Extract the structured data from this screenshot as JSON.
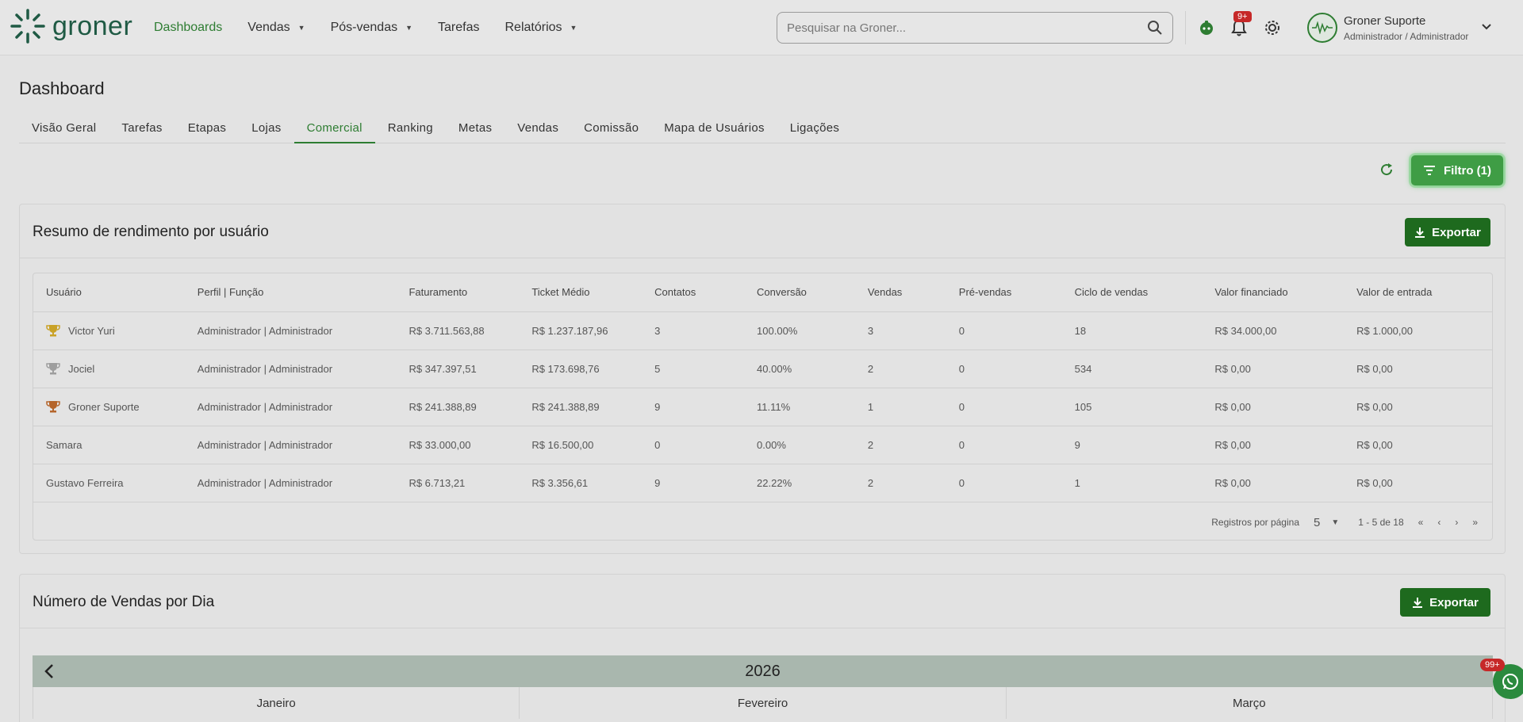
{
  "brand": {
    "name": "groner",
    "color": "#1f5a44",
    "accent": "#2e7d32"
  },
  "nav": [
    {
      "label": "Dashboards",
      "active": true,
      "dropdown": false
    },
    {
      "label": "Vendas",
      "active": false,
      "dropdown": true
    },
    {
      "label": "Pós-vendas",
      "active": false,
      "dropdown": true
    },
    {
      "label": "Tarefas",
      "active": false,
      "dropdown": false
    },
    {
      "label": "Relatórios",
      "active": false,
      "dropdown": true
    }
  ],
  "search": {
    "placeholder": "Pesquisar na Groner..."
  },
  "notifications": {
    "badge": "9+"
  },
  "user": {
    "name": "Groner Suporte",
    "role": "Administrador / Administrador"
  },
  "page": {
    "title": "Dashboard"
  },
  "tabs": [
    {
      "label": "Visão Geral",
      "active": false
    },
    {
      "label": "Tarefas",
      "active": false
    },
    {
      "label": "Etapas",
      "active": false
    },
    {
      "label": "Lojas",
      "active": false
    },
    {
      "label": "Comercial",
      "active": true
    },
    {
      "label": "Ranking",
      "active": false
    },
    {
      "label": "Metas",
      "active": false
    },
    {
      "label": "Vendas",
      "active": false
    },
    {
      "label": "Comissão",
      "active": false
    },
    {
      "label": "Mapa de Usuários",
      "active": false
    },
    {
      "label": "Ligações",
      "active": false
    }
  ],
  "toolbar": {
    "filter_label": "Filtro (1)"
  },
  "summary": {
    "title": "Resumo de rendimento por usuário",
    "export_label": "Exportar",
    "columns": [
      "Usuário",
      "Perfil | Função",
      "Faturamento",
      "Ticket Médio",
      "Contatos",
      "Conversão",
      "Vendas",
      "Pré-vendas",
      "Ciclo de vendas",
      "Valor financiado",
      "Valor de entrada"
    ],
    "rows": [
      {
        "trophy": "gold",
        "cells": [
          "Victor Yuri",
          "Administrador | Administrador",
          "R$ 3.711.563,88",
          "R$ 1.237.187,96",
          "3",
          "100.00%",
          "3",
          "0",
          "18",
          "R$ 34.000,00",
          "R$ 1.000,00"
        ]
      },
      {
        "trophy": "silver",
        "cells": [
          "Jociel",
          "Administrador | Administrador",
          "R$ 347.397,51",
          "R$ 173.698,76",
          "5",
          "40.00%",
          "2",
          "0",
          "534",
          "R$ 0,00",
          "R$ 0,00"
        ]
      },
      {
        "trophy": "bronze",
        "cells": [
          "Groner Suporte",
          "Administrador | Administrador",
          "R$ 241.388,89",
          "R$ 241.388,89",
          "9",
          "11.11%",
          "1",
          "0",
          "105",
          "R$ 0,00",
          "R$ 0,00"
        ]
      },
      {
        "trophy": "",
        "cells": [
          "Samara",
          "Administrador | Administrador",
          "R$ 33.000,00",
          "R$ 16.500,00",
          "0",
          "0.00%",
          "2",
          "0",
          "9",
          "R$ 0,00",
          "R$ 0,00"
        ]
      },
      {
        "trophy": "",
        "cells": [
          "Gustavo Ferreira",
          "Administrador | Administrador",
          "R$ 6.713,21",
          "R$ 3.356,61",
          "9",
          "22.22%",
          "2",
          "0",
          "1",
          "R$ 0,00",
          "R$ 0,00"
        ]
      }
    ],
    "pager": {
      "per_page_label": "Registros por página",
      "per_page": "5",
      "range": "1 - 5 de 18"
    }
  },
  "sales_per_day": {
    "title": "Número de Vendas por Dia",
    "export_label": "Exportar",
    "year": "2026",
    "months": [
      "Janeiro",
      "Fevereiro",
      "Março"
    ]
  },
  "chat": {
    "badge": "99+"
  },
  "colors": {
    "gold": "#c9a227",
    "silver": "#9e9e9e",
    "bronze": "#b5652b",
    "export_bg": "#1e6a1e",
    "filter_bg": "#3f9d45"
  }
}
